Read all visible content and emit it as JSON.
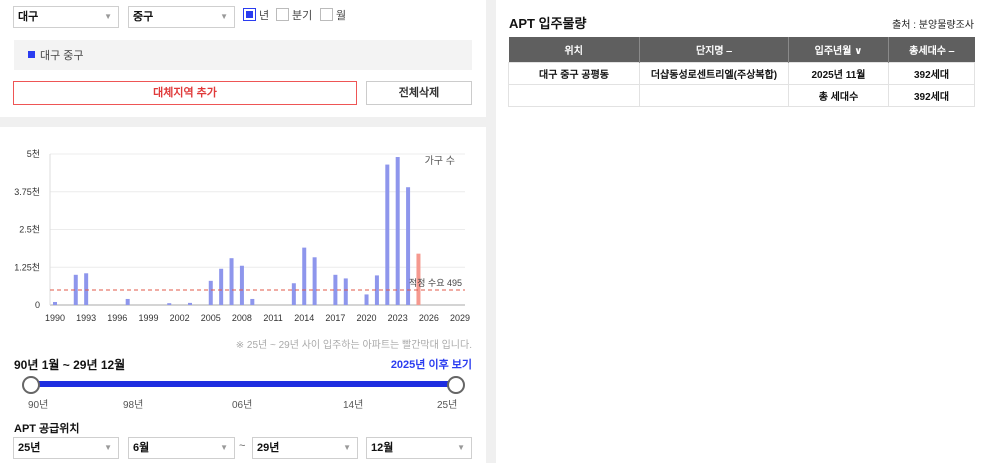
{
  "filters": {
    "city": "대구",
    "district": "중구",
    "period_options": [
      {
        "label": "년",
        "checked": true
      },
      {
        "label": "분기",
        "checked": false
      },
      {
        "label": "월",
        "checked": false
      }
    ]
  },
  "region_tag": "대구 중구",
  "buttons": {
    "add_region": "대체지역 추가",
    "delete_all": "전체삭제"
  },
  "chart_data": {
    "type": "bar",
    "legend": "가구 수",
    "ylim": [
      0,
      5000
    ],
    "ytick_labels": [
      "0",
      "1.25천",
      "2.5천",
      "3.75천",
      "5천"
    ],
    "ytick_values": [
      0,
      1250,
      2500,
      3750,
      5000
    ],
    "xtick_labels": [
      "1990",
      "1993",
      "1996",
      "1999",
      "2002",
      "2005",
      "2008",
      "2011",
      "2014",
      "2017",
      "2020",
      "2023",
      "2026",
      "2029"
    ],
    "xtick_values": [
      1990,
      1993,
      1996,
      1999,
      2002,
      2005,
      2008,
      2011,
      2014,
      2017,
      2020,
      2023,
      2026,
      2029
    ],
    "x": [
      1990,
      1992,
      1993,
      1997,
      2001,
      2003,
      2005,
      2006,
      2007,
      2008,
      2009,
      2013,
      2014,
      2015,
      2017,
      2018,
      2020,
      2021,
      2022,
      2023,
      2024,
      2025
    ],
    "values": [
      100,
      1000,
      1050,
      200,
      60,
      70,
      800,
      1200,
      1550,
      1300,
      200,
      720,
      1900,
      1580,
      1000,
      880,
      350,
      980,
      4650,
      4900,
      3900,
      1700
    ],
    "highlight_from": 2025,
    "bar_color": "#8e96ec",
    "highlight_color": "#f5998f",
    "reference_line": {
      "label": "적정 수요",
      "value": 495,
      "value_label": "495",
      "color": "#e05a4a"
    }
  },
  "note": "※ 25년 ~ 29년 사이 입주하는 아파트는 빨간막대 입니다.",
  "range": {
    "label": "90년 1월 ~ 29년 12월",
    "after_link": "2025년 이후 보기",
    "ticks": [
      "90년",
      "98년",
      "06년",
      "14년",
      "25년"
    ]
  },
  "supply": {
    "title": "APT 공급위치",
    "from_year": "25년",
    "from_month": "6월",
    "sep": "~",
    "to_year": "29년",
    "to_month": "12월"
  },
  "apt": {
    "title": "APT 입주물량",
    "source": "출처 : 분양물량조사",
    "headers": [
      "위치",
      "단지명 ‒",
      "입주년월 ∨",
      "총세대수 ‒"
    ],
    "rows": [
      [
        "대구 중구 공평동",
        "더샵동성로센트리엘(주상복합)",
        "2025년 11월",
        "392세대"
      ],
      [
        "",
        "",
        "총 세대수",
        "392세대"
      ]
    ]
  }
}
